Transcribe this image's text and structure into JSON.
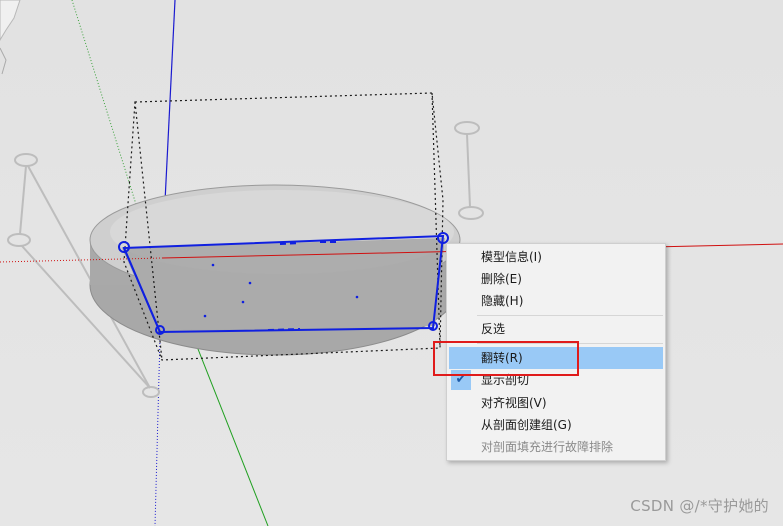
{
  "context_menu": {
    "items": [
      {
        "label": "模型信息(I)",
        "state": "normal"
      },
      {
        "label": "删除(E)",
        "state": "normal"
      },
      {
        "label": "隐藏(H)",
        "state": "normal"
      },
      {
        "label": "反选",
        "state": "normal"
      },
      {
        "label": "翻转(R)",
        "state": "highlighted"
      },
      {
        "label": "显示剖切",
        "state": "checked"
      },
      {
        "label": "对齐视图(V)",
        "state": "normal"
      },
      {
        "label": "从剖面创建组(G)",
        "state": "normal"
      },
      {
        "label": "对剖面填充进行故障排除",
        "state": "disabled"
      }
    ]
  },
  "watermark": {
    "text": "CSDN @/*守护她的"
  },
  "colors": {
    "axis_red": "#d01010",
    "axis_green": "#10a010",
    "axis_blue": "#1010d0",
    "section_plane": "#1020e0",
    "highlight": "#99c9f6",
    "annotation_box": "#e01b1b"
  },
  "icons": {
    "checkmark": "checkmark-icon"
  }
}
